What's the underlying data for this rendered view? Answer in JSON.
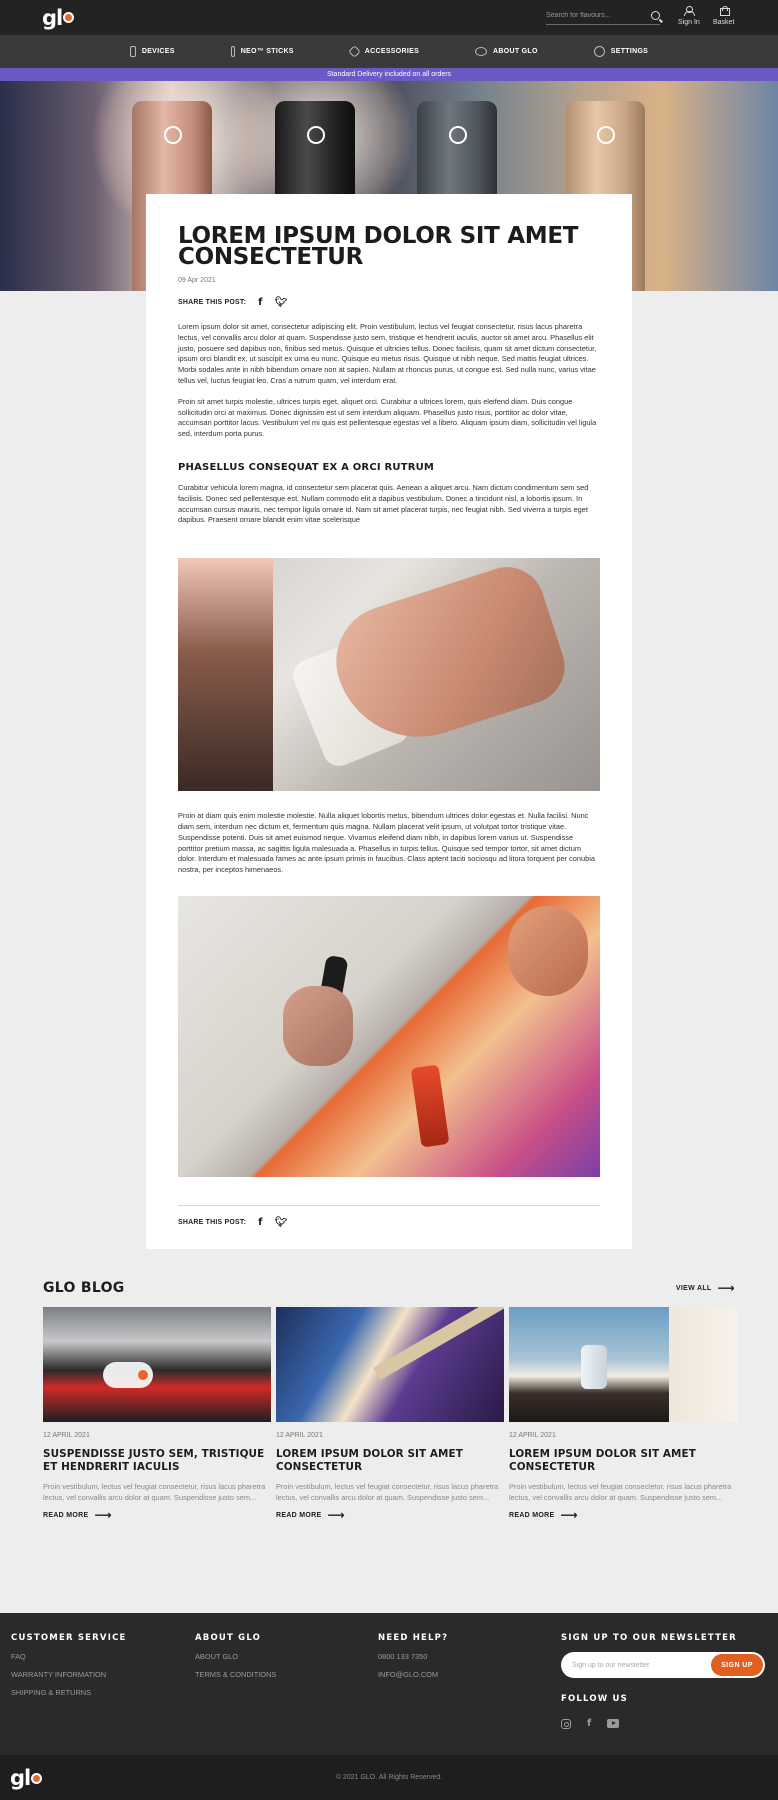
{
  "header": {
    "logo": "glo",
    "search_placeholder": "Search for flavours...",
    "sign_in": "Sign In",
    "basket": "Basket"
  },
  "nav": {
    "items": [
      {
        "label": "DEVICES",
        "icon": "device-icon"
      },
      {
        "label": "NEO™ STICKS",
        "icon": "stick-icon"
      },
      {
        "label": "ACCESSORIES",
        "icon": "accessories-icon"
      },
      {
        "label": "ABOUT GLO",
        "icon": "glo-icon"
      },
      {
        "label": "SETTINGS",
        "icon": "gear-icon"
      }
    ]
  },
  "promo": "Standard Delivery included on all orders",
  "article": {
    "title": "LOREM IPSUM DOLOR SIT AMET CONSECTETUR",
    "date": "09 Apr 2021",
    "share_label": "SHARE THIS POST:",
    "paragraphs": [
      "Lorem ipsum dolor sit amet, consectetur adipiscing elit. Proin vestibulum, lectus vel feugiat consectetur, risus lacus pharetra lectus, vel convallis arcu dolor at quam. Suspendisse justo sem, tristique et hendrerit iaculis, auctor sit amet arcu. Phasellus elit justo, posuere sed dapibus non, finibus sed metus. Quisque et ultricies tellus. Donec facilisis, quam sit amet dictum consectetur, ipsum orci blandit ex, ut suscipit ex urna eu nunc. Quisque eu metus risus. Quisque ut nibh neque. Sed mattis feugiat ultrices. Morbi sodales ante in nibh bibendum ornare non at sapien. Nullam at rhoncus purus, ut congue est. Sed nulla nunc, varius vitae tellus vel, luctus feugiat leo. Cras a rutrum quam, vel interdum erat.",
      "Proin sit amet turpis molestie, ultrices turpis eget, aliquet orci. Curabitur a ultrices lorem, quis eleifend diam. Duis congue sollicitudin orci at maximus. Donec dignissim est ut sem interdum aliquam. Phasellus justo risus, porttitor ac dolor vitae, accumsan porttitor lacus. Vestibulum vel mi quis est pellentesque egestas vel a libero. Aliquam ipsum diam, sollicitudin vel ligula sed, interdum porta purus."
    ],
    "subheading": "PHASELLUS CONSEQUAT EX A ORCI RUTRUM",
    "paragraph3": "Curabitur vehicula lorem magna, id consectetur sem placerat quis. Aenean a aliquet arcu. Nam dictum condimentum sem sed facilisis. Donec sed pellentesque est. Nullam commodo elit a dapibus vestibulum. Donec a tincidunt nisl, a lobortis ipsum. In accumsan cursus mauris, nec tempor ligula ornare id. Nam sit amet placerat turpis, nec feugiat nibh. Sed viverra a turpis eget dapibus. Praesent ornare blandit enim vitae scelerisque",
    "paragraph4": "Proin at diam quis enim molestie molestie. Nulla aliquet lobortis metus, bibendum ultrices dolor egestas et. Nulla facilisi. Nunc diam sem, interdum nec dictum et, fermentum quis magna. Nullam placerat velit ipsum, ut volutpat tortor tristique vitae. Suspendisse potenti. Duis sit amet euismod neque. Vivamus eleifend diam nibh, in dapibus lorem varius ut. Suspendisse porttitor pretium massa, ac sagittis ligula malesuada a. Phasellus in turpis tellus. Quisque sed tempor tortor, sit amet dictum dolor. Interdum et malesuada fames ac ante ipsum primis in faucibus. Class aptent taciti sociosqu ad litora torquent per conubia nostra, per inceptos himenaeos."
  },
  "blog": {
    "title": "GLO BLOG",
    "view_all": "VIEW ALL",
    "cards": [
      {
        "date": "12 APRIL 2021",
        "title": "SUSPENDISSE JUSTO SEM, TRISTIQUE ET HENDRERIT IACULIS",
        "excerpt": "Proin vestibulum, lectus vel feugiat consectetur, risus lacus pharetra lectus, vel convallis arcu dolor at quam. Suspendisse justo sem...",
        "read_more": "READ MORE"
      },
      {
        "date": "12 APRIL 2021",
        "title": "LOREM IPSUM DOLOR SIT AMET CONSECTETUR",
        "excerpt": "Proin vestibulum, lectus vel feugiat consectetur, risus lacus pharetra lectus, vel convallis arcu dolor at quam. Suspendisse justo sem...",
        "read_more": "READ MORE"
      },
      {
        "date": "12 APRIL 2021",
        "title": "LOREM IPSUM DOLOR SIT AMET CONSECTETUR",
        "excerpt": "Proin vestibulum, lectus vel feugiat consectetur, risus lacus pharetra lectus, vel convallis arcu dolor at quam. Suspendisse justo sem...",
        "read_more": "READ MORE"
      }
    ]
  },
  "footer": {
    "customer_service": {
      "title": "CUSTOMER SERVICE",
      "links": [
        "FAQ",
        "WARRANTY INFORMATION",
        "SHIPPING & RETURNS"
      ]
    },
    "about": {
      "title": "ABOUT GLO",
      "links": [
        "ABOUT GLO",
        "TERMS & CONDITIONS"
      ]
    },
    "help": {
      "title": "NEED HELP?",
      "links": [
        "0800 133 7350",
        "INFO@GLO.COM"
      ]
    },
    "newsletter": {
      "title": "SIGN UP TO OUR NEWSLETTER",
      "placeholder": "Sign up to our newsletter",
      "button": "SIGN UP"
    },
    "follow": "FOLLOW US",
    "copyright": "© 2021 GLO. All Rights Reserved."
  },
  "colors": {
    "accent": "#e2601f",
    "promo": "#6c59c6",
    "header": "#232323"
  }
}
